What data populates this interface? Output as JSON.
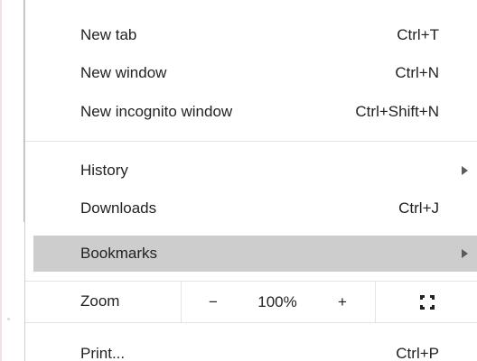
{
  "menu": {
    "new_tab": {
      "label": "New tab",
      "shortcut": "Ctrl+T"
    },
    "new_window": {
      "label": "New window",
      "shortcut": "Ctrl+N"
    },
    "new_incognito": {
      "label": "New incognito window",
      "shortcut": "Ctrl+Shift+N"
    },
    "history": {
      "label": "History"
    },
    "downloads": {
      "label": "Downloads",
      "shortcut": "Ctrl+J"
    },
    "bookmarks": {
      "label": "Bookmarks"
    },
    "zoom": {
      "label": "Zoom",
      "minus": "−",
      "level": "100%",
      "plus": "+"
    },
    "print": {
      "label": "Print...",
      "shortcut": "Ctrl+P"
    }
  },
  "icons": {
    "submenu_arrow": "chevron-right-icon",
    "fullscreen": "fullscreen-icon"
  },
  "colors": {
    "highlight": "#cdcdcd",
    "text": "#222222",
    "separator": "#e3e3e3"
  }
}
